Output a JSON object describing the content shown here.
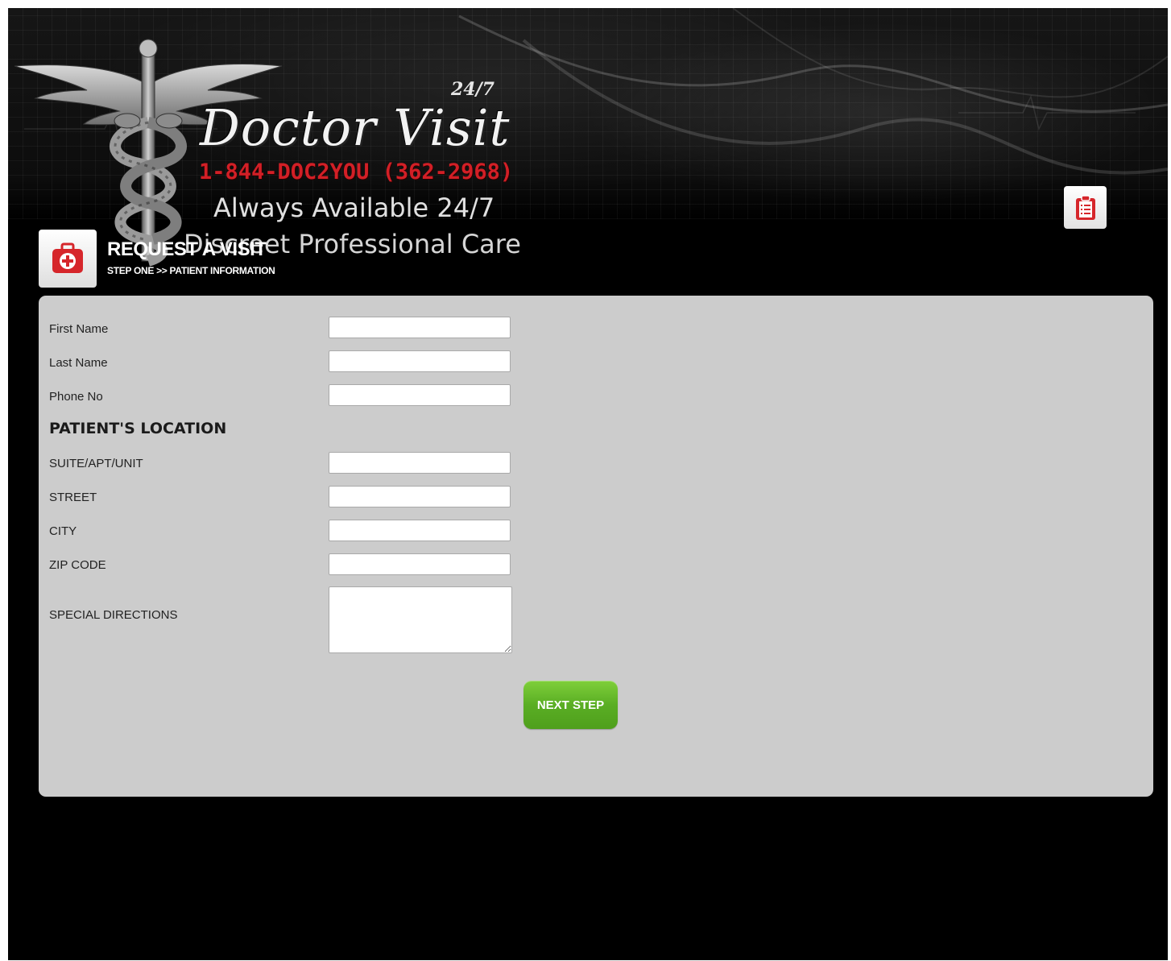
{
  "header": {
    "logo": {
      "script_text": "Doctor Visit",
      "badge_text": "24/7",
      "phone": "1-844-DOC2YOU (362-2968)",
      "tagline_1": "Always Available 24/7",
      "tagline_2": "Discreet Professional Care"
    },
    "clipboard_icon": "clipboard-icon",
    "medkit_icon": "medical-kit-icon"
  },
  "page": {
    "title": "REQUEST A VISIT",
    "step": "STEP ONE >> PATIENT INFORMATION"
  },
  "form": {
    "first_name": {
      "label": "First Name",
      "value": ""
    },
    "last_name": {
      "label": "Last Name",
      "value": ""
    },
    "phone": {
      "label": "Phone No",
      "value": ""
    },
    "location_heading": "PATIENT'S LOCATION",
    "suite": {
      "label": "SUITE/APT/UNIT",
      "value": ""
    },
    "street": {
      "label": "STREET",
      "value": ""
    },
    "city": {
      "label": "CITY",
      "value": ""
    },
    "zip": {
      "label": "ZIP CODE",
      "value": ""
    },
    "special_directions": {
      "label": "SPECIAL DIRECTIONS",
      "value": ""
    },
    "submit_label": "NEXT STEP"
  },
  "colors": {
    "background": "#000000",
    "panel": "#cccccc",
    "phone_red": "#d21f26",
    "button_green": "#5aae24",
    "icon_red": "#d6262b"
  }
}
